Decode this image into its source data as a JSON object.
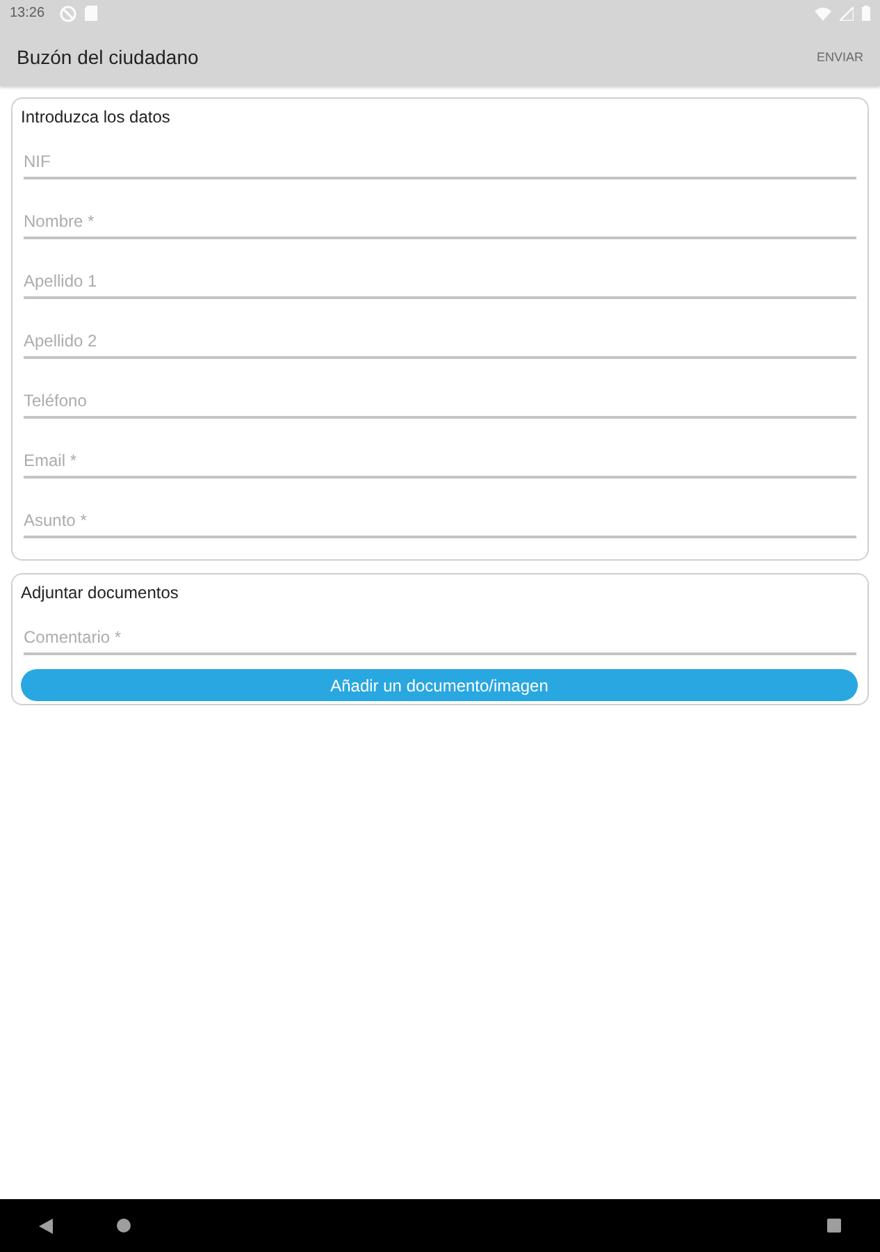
{
  "status_bar": {
    "time": "13:26"
  },
  "app_bar": {
    "title": "Buzón del ciudadano",
    "action": {
      "label": "ENVIAR",
      "disabled": true
    }
  },
  "sections": [
    {
      "title": "Introduzca los datos",
      "fields": [
        {
          "placeholder": "NIF"
        },
        {
          "placeholder": "Nombre *"
        },
        {
          "placeholder": "Apellido 1"
        },
        {
          "placeholder": "Apellido 2"
        },
        {
          "placeholder": "Teléfono"
        },
        {
          "placeholder": "Email *"
        },
        {
          "placeholder": "Asunto *"
        }
      ]
    },
    {
      "title": "Adjuntar documentos",
      "fields": [
        {
          "placeholder": "Comentario *"
        }
      ],
      "button": "Añadir un documento/imagen"
    }
  ]
}
